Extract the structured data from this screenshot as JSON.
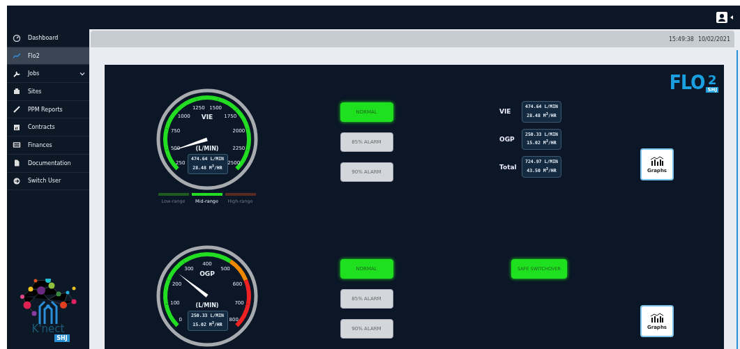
{
  "sidebar": {
    "items": [
      {
        "label": "Dashboard",
        "selected": false,
        "expandable": false
      },
      {
        "label": "Flo2",
        "selected": true,
        "expandable": false
      },
      {
        "label": "Jobs",
        "selected": false,
        "expandable": true
      },
      {
        "label": "Sites",
        "selected": false,
        "expandable": false
      },
      {
        "label": "PPM Reports",
        "selected": false,
        "expandable": false
      },
      {
        "label": "Contracts",
        "selected": false,
        "expandable": false
      },
      {
        "label": "Finances",
        "selected": false,
        "expandable": false
      },
      {
        "label": "Documentation",
        "selected": false,
        "expandable": false
      },
      {
        "label": "Switch User",
        "selected": false,
        "expandable": false
      }
    ],
    "logo": {
      "name": "K'nect",
      "badge": "SHJ"
    }
  },
  "status_bar": {
    "time": "15:49:38",
    "date": "10/02/2021"
  },
  "brand": {
    "text": "FLO",
    "subscript": "2",
    "badge": "SHJ"
  },
  "rows": [
    {
      "gauge": {
        "title": "VIE",
        "unit": "(L/MIN)",
        "ticks": [
          "250",
          "500",
          "750",
          "1000",
          "1250",
          "1500",
          "1750",
          "2000",
          "2250",
          "2500"
        ],
        "segments": [
          {
            "color": "#22dd22"
          },
          {
            "color": "#22dd22"
          },
          {
            "color": "#22dd22"
          },
          {
            "color": "#22dd22"
          },
          {
            "color": "#22dd22"
          },
          {
            "color": "#22dd22"
          },
          {
            "color": "#22dd22"
          },
          {
            "color": "#22dd22"
          },
          {
            "color": "#22dd22"
          }
        ],
        "flow": "474.64 L/MIN",
        "volume": "28.48 M$^{3}$/HR"
      },
      "ranges": [
        {
          "label": "Low-range",
          "selected": false,
          "color": "#1f5a1f"
        },
        {
          "label": "Mid-range",
          "selected": true,
          "color": "#22dd22"
        },
        {
          "label": "High-range",
          "selected": false,
          "color": "#5a2a22"
        }
      ],
      "alarms": [
        {
          "label": "NORMAL",
          "on": true
        },
        {
          "label": "85% ALARM",
          "on": false
        },
        {
          "label": "90% ALARM",
          "on": false
        }
      ],
      "totals": [
        {
          "label": "VIE",
          "flow": "474.64 L/MIN",
          "volume": "28.48 M$^{3}$/HR"
        },
        {
          "label": "OGP",
          "flow": "250.33 L/MIN",
          "volume": "15.02 M$^{3}$/HR"
        },
        {
          "label": "Total",
          "flow": "724.97 L/MIN",
          "volume": "43.50 M$^{3}$/HR"
        }
      ],
      "graphs_button": "Graphs"
    },
    {
      "gauge": {
        "title": "OGP",
        "unit": "(L/MIN)",
        "ticks": [
          "0",
          "100",
          "200",
          "300",
          "400",
          "500",
          "600",
          "700",
          "800"
        ],
        "segments": [
          {
            "color": "#22dd22"
          },
          {
            "color": "#22dd22"
          },
          {
            "color": "#22dd22"
          },
          {
            "color": "#22dd22"
          },
          {
            "color": "#22dd22"
          },
          {
            "color": "#ee8800"
          },
          {
            "color": "#ee2222"
          },
          {
            "color": "#ee2222"
          }
        ],
        "flow": "250.33 L/MIN",
        "volume": "15.02 M$^{3}$/HR"
      },
      "alarms": [
        {
          "label": "NORMAL",
          "on": true
        },
        {
          "label": "85% ALARM",
          "on": false
        },
        {
          "label": "90% ALARM",
          "on": false
        }
      ],
      "switchover": {
        "label": "SAFE SWITCHOVER",
        "on": true
      },
      "graphs_button": "Graphs"
    }
  ]
}
